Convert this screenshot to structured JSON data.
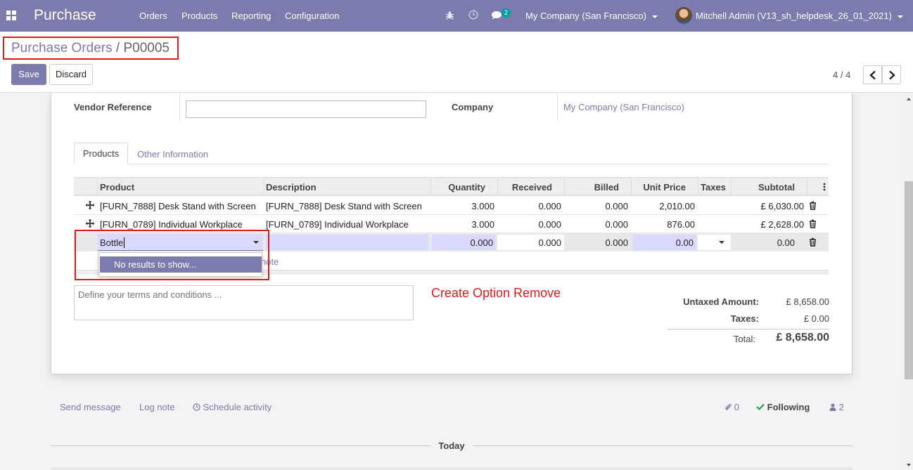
{
  "navbar": {
    "app_name": "Purchase",
    "menu": [
      "Orders",
      "Products",
      "Reporting",
      "Configuration"
    ],
    "message_count": "2",
    "company": "My Company (San Francisco)",
    "user": "Mitchell Admin (V13_sh_helpdesk_26_01_2021)",
    "icons": [
      "apps-grid-icon",
      "bug-icon",
      "clock-icon",
      "chat-icon"
    ],
    "bg_color": "#7c7bad"
  },
  "breadcrumb": {
    "parent": "Purchase Orders",
    "separator": "/",
    "current": "P00005"
  },
  "toolbar": {
    "save_label": "Save",
    "discard_label": "Discard",
    "pager": "4 / 4"
  },
  "form": {
    "vendor_reference_label": "Vendor Reference",
    "vendor_reference_value": "",
    "company_label": "Company",
    "company_value": "My Company (San Francisco)"
  },
  "tabs": [
    "Products",
    "Other Information"
  ],
  "table": {
    "columns": [
      "Product",
      "Description",
      "Quantity",
      "Received",
      "Billed",
      "Unit Price",
      "Taxes",
      "Subtotal"
    ],
    "rows": [
      {
        "product": "[FURN_7888] Desk Stand with Screen",
        "description": "[FURN_7888] Desk Stand with Screen",
        "quantity": "3.000",
        "received": "0.000",
        "billed": "0.000",
        "unit_price": "2,010.00",
        "taxes": "",
        "subtotal": "£ 6,030.00"
      },
      {
        "product": "[FURN_0789] Individual Workplace",
        "description": "[FURN_0789] Individual Workplace",
        "quantity": "3.000",
        "received": "0.000",
        "billed": "0.000",
        "unit_price": "876.00",
        "taxes": "",
        "subtotal": "£ 2,628.00"
      }
    ],
    "edit_row": {
      "product_input": "Bottle",
      "quantity": "0.000",
      "received": "0.000",
      "billed": "0.000",
      "unit_price": "0.00",
      "subtotal": "0.00"
    },
    "dropdown_item": "No results to show...",
    "add_note_fragment": "note"
  },
  "notes_placeholder": "Define your terms and conditions ...",
  "annotation": "Create Option Remove",
  "totals": {
    "untaxed_label": "Untaxed Amount:",
    "untaxed_value": "£ 8,658.00",
    "taxes_label": "Taxes:",
    "taxes_value": "£ 0.00",
    "total_label": "Total:",
    "total_value": "£ 8,658.00"
  },
  "chatter": {
    "send_message": "Send message",
    "log_note": "Log note",
    "schedule_activity": "Schedule activity",
    "attachments": "0",
    "following": "Following",
    "followers": "2",
    "today": "Today"
  }
}
